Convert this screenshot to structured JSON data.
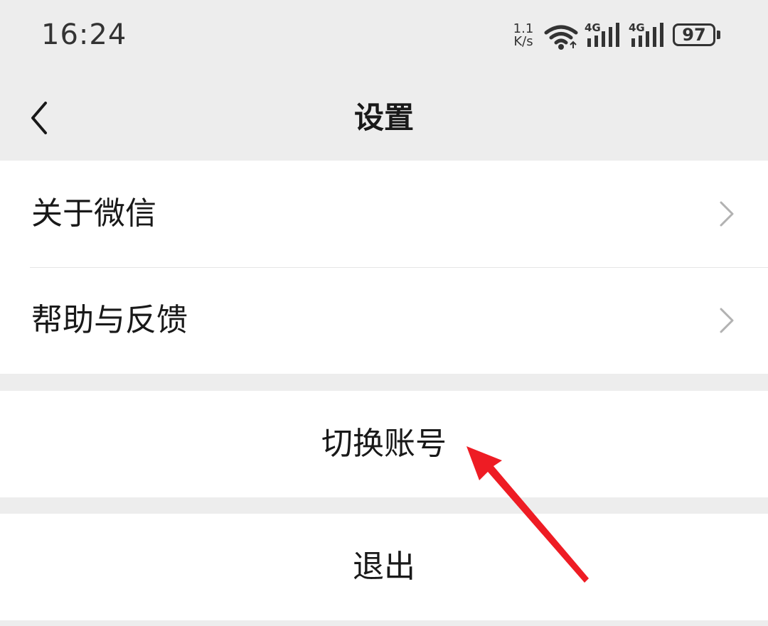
{
  "status_bar": {
    "time": "16:24",
    "net_speed_value": "1.1",
    "net_speed_unit": "K/s",
    "signal1_label": "4G",
    "signal2_label": "4G",
    "battery_level": "97",
    "wifi_icon": "wifi-icon",
    "signal_icon": "cellular-signal-icon",
    "battery_icon": "battery-icon"
  },
  "nav": {
    "title": "设置",
    "back_icon": "chevron-left-icon"
  },
  "list": {
    "items": [
      {
        "label": "关于微信",
        "icon": "chevron-right-icon"
      },
      {
        "label": "帮助与反馈",
        "icon": "chevron-right-icon"
      }
    ]
  },
  "actions": {
    "switch_account": "切换账号",
    "logout": "退出"
  },
  "annotation": {
    "icon": "red-arrow-icon",
    "color": "#ee1c24"
  },
  "colors": {
    "background": "#ededed",
    "surface": "#ffffff",
    "text": "#191919",
    "chevron": "#b2b2b2",
    "divider": "#e5e5e5"
  }
}
